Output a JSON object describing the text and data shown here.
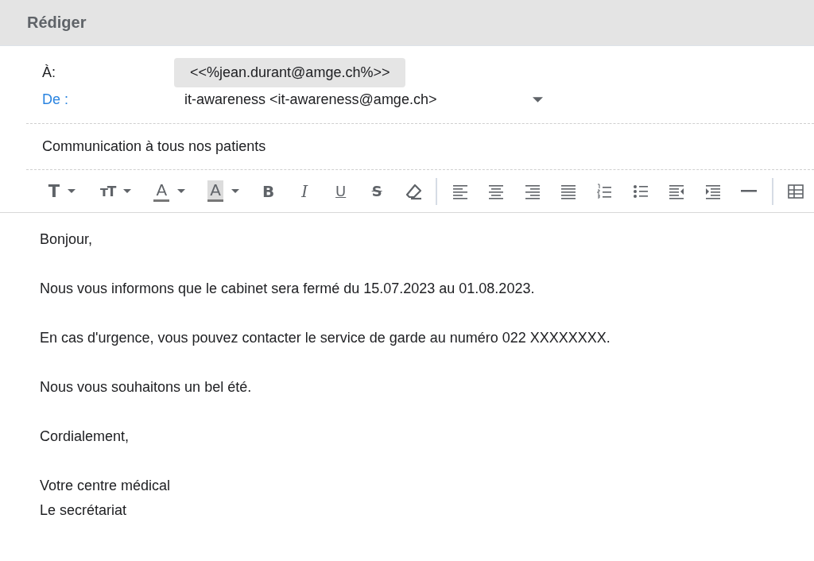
{
  "header": {
    "title": "Rédiger"
  },
  "to": {
    "label": "À:",
    "recipient": "<<%jean.durant@amge.ch%>>"
  },
  "from": {
    "label": "De :",
    "value": "it-awareness <it-awareness@amge.ch>"
  },
  "subject": {
    "value": "Communication à tous nos patients"
  },
  "toolbar": [
    {
      "kind": "text-style",
      "label": "T",
      "dropdown": true
    },
    {
      "kind": "font-size",
      "label": "тT",
      "dropdown": true
    },
    {
      "kind": "font-color",
      "label": "A",
      "dropdown": true
    },
    {
      "kind": "highlight",
      "label": "A",
      "dropdown": true
    },
    {
      "kind": "bold",
      "label": "B",
      "dropdown": false
    },
    {
      "kind": "italic",
      "label": "I",
      "dropdown": false
    },
    {
      "kind": "underline",
      "label": "U",
      "dropdown": false
    },
    {
      "kind": "strike",
      "label": "S",
      "dropdown": false
    },
    {
      "kind": "eraser",
      "dropdown": false
    },
    {
      "kind": "separator"
    },
    {
      "kind": "align-left",
      "dropdown": false
    },
    {
      "kind": "align-center",
      "dropdown": false
    },
    {
      "kind": "align-right",
      "dropdown": false
    },
    {
      "kind": "justify",
      "dropdown": false
    },
    {
      "kind": "numbered-list",
      "dropdown": false
    },
    {
      "kind": "bullet-list",
      "dropdown": false
    },
    {
      "kind": "outdent",
      "dropdown": false
    },
    {
      "kind": "indent",
      "dropdown": false
    },
    {
      "kind": "horizontal-rule",
      "dropdown": false
    },
    {
      "kind": "separator"
    },
    {
      "kind": "table",
      "dropdown": false
    }
  ],
  "body": [
    [
      "Bonjour,"
    ],
    [
      "Nous vous informons que le cabinet sera fermé du 15.07.2023 au 01.08.2023."
    ],
    [
      "En cas d'urgence, vous pouvez contacter le service de garde au numéro 022 XXXXXXXX."
    ],
    [
      "Nous vous souhaitons un bel été."
    ],
    [
      "Cordialement,"
    ],
    [
      "Votre centre médical",
      "Le secrétariat"
    ]
  ]
}
